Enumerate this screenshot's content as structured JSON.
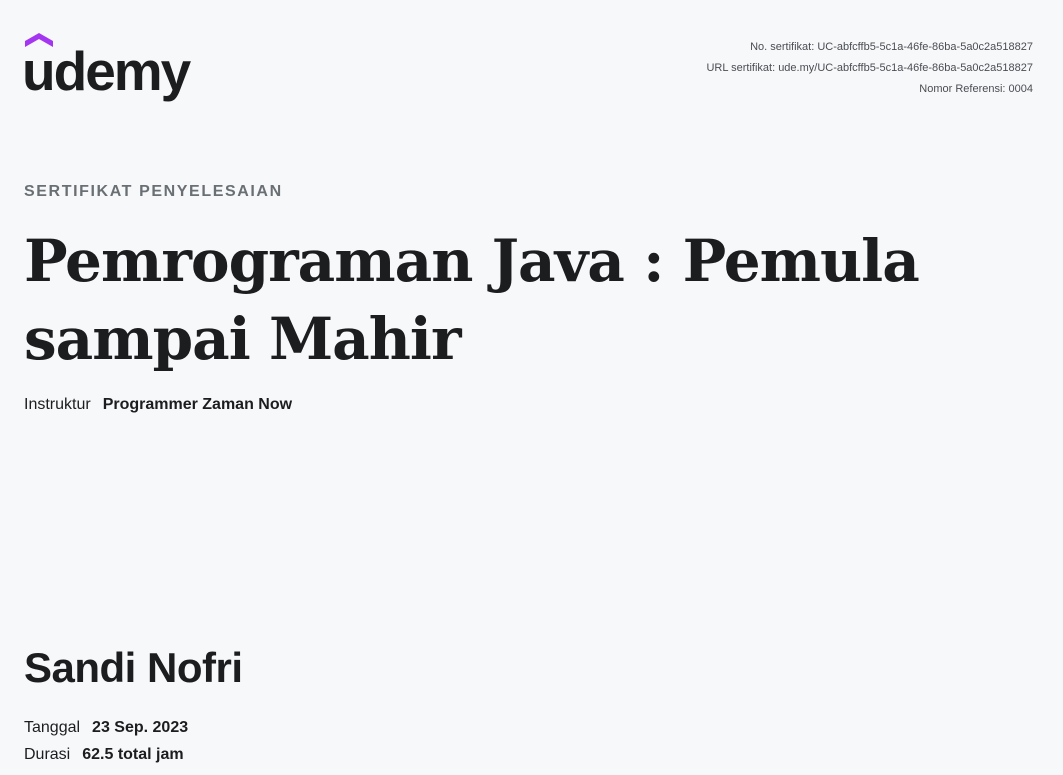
{
  "brand": {
    "name": "udemy",
    "accent_color": "#a435f0",
    "logo_icon": "udemy-logo-icon"
  },
  "certificate_meta": {
    "number": "No. sertifikat: UC-abfcffb5-5c1a-46fe-86ba-5a0c2a518827",
    "url": "URL sertifikat: ude.my/UC-abfcffb5-5c1a-46fe-86ba-5a0c2a518827",
    "reference": "Nomor Referensi: 0004"
  },
  "certificate": {
    "type_label": "SERTIFIKAT PENYELESAIAN",
    "course_title": "Pemrograman Java : Pemula sampai Mahir",
    "instructor_label": "Instruktur",
    "instructor_name": "Programmer Zaman Now"
  },
  "recipient": {
    "name": "Sandi Nofri",
    "date_label": "Tanggal",
    "date_value": "23 Sep. 2023",
    "duration_label": "Durasi",
    "duration_value": "62.5 total jam"
  }
}
